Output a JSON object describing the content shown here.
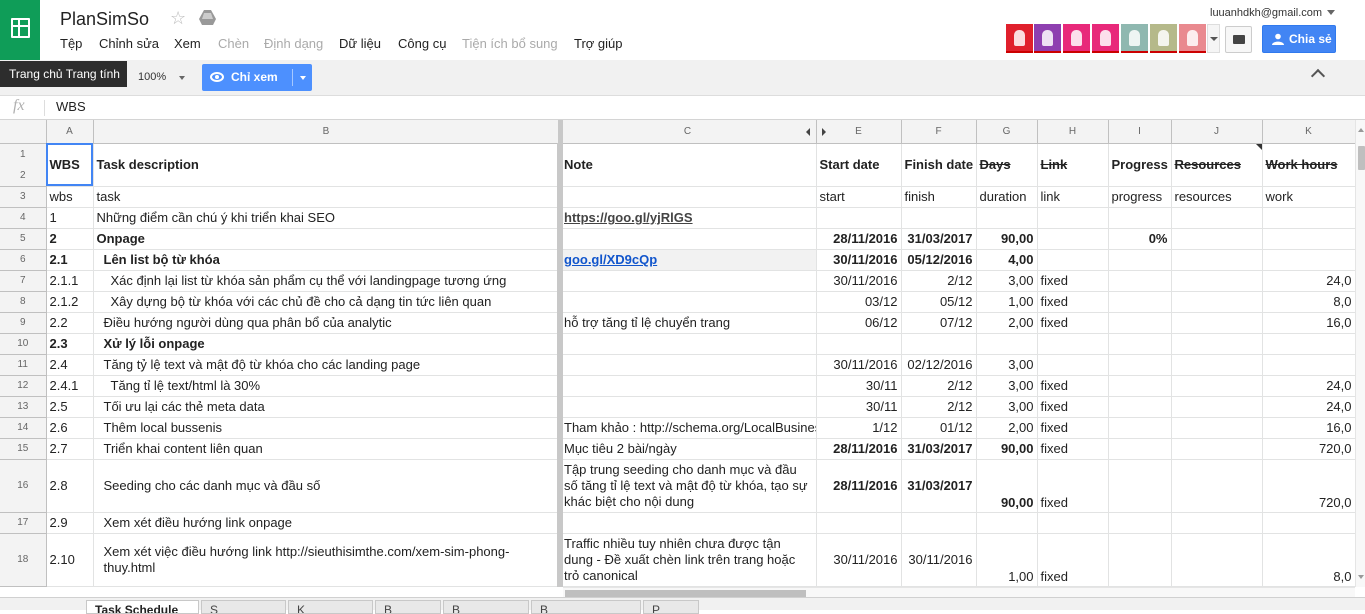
{
  "app": {
    "title": "PlanSimSo",
    "account": "luuanhdkh@gmail.com"
  },
  "menu": [
    {
      "label": "Tệp",
      "enabled": true
    },
    {
      "label": "Chỉnh sửa",
      "enabled": true
    },
    {
      "label": "Xem",
      "enabled": true
    },
    {
      "label": "Chèn",
      "enabled": false
    },
    {
      "label": "Định dạng",
      "enabled": false
    },
    {
      "label": "Dữ liệu",
      "enabled": true
    },
    {
      "label": "Công cụ",
      "enabled": true
    },
    {
      "label": "Tiện ích bổ sung",
      "enabled": false
    },
    {
      "label": "Trợ giúp",
      "enabled": true
    }
  ],
  "toolbar": {
    "home_tooltip": "Trang chủ Trang tính",
    "zoom": "100%",
    "view_only": "Chỉ xem",
    "share": "Chia sẻ"
  },
  "collaborators": [
    {
      "color": "#e0202c"
    },
    {
      "color": "#8e3fb0"
    },
    {
      "color": "#e8297a"
    },
    {
      "color": "#e8297a"
    },
    {
      "color": "#8fb8b0"
    },
    {
      "color": "#b5b98a"
    },
    {
      "color": "#e9898f"
    }
  ],
  "formula_bar": {
    "value": "WBS"
  },
  "columns": [
    "A",
    "B",
    "C",
    "E",
    "F",
    "G",
    "H",
    "I",
    "J",
    "K"
  ],
  "rows": [
    {
      "n": "1",
      "n2": "2",
      "wbs": "WBS",
      "task": "Task description",
      "note": "Note",
      "start": "Start date",
      "finish": "Finish date",
      "days": "Days",
      "link": "Link",
      "progress": "Progress",
      "resources": "Resources",
      "work": "Work hours"
    },
    {
      "n": "3",
      "wbs": "wbs",
      "task": "task",
      "note": "",
      "start": "start",
      "finish": "finish",
      "days": "duration",
      "link": "link",
      "progress": "progress",
      "resources": "resources",
      "work": "work"
    },
    {
      "n": "4",
      "wbs": "1",
      "task": "Những điểm cần chú ý khi triển khai SEO",
      "note": "https://goo.gl/yjRlGS",
      "start": "",
      "finish": "",
      "days": "",
      "link": "",
      "progress": "",
      "resources": "",
      "work": ""
    },
    {
      "n": "5",
      "wbs": "2",
      "task": "Onpage",
      "note": "",
      "start": "28/11/2016",
      "finish": "31/03/2017",
      "days": "90,00",
      "link": "",
      "progress": "0%",
      "resources": "",
      "work": ""
    },
    {
      "n": "6",
      "wbs": "2.1",
      "task": "Lên list bộ từ khóa",
      "note": "goo.gl/XD9cQp",
      "start": "30/11/2016",
      "finish": "05/12/2016",
      "days": "4,00",
      "link": "",
      "progress": "",
      "resources": "",
      "work": ""
    },
    {
      "n": "7",
      "wbs": "2.1.1",
      "task": "Xác định lại list từ khóa sản phẩm cụ thể với landingpage tương ứng",
      "note": "",
      "start": "30/11/2016",
      "finish": "2/12",
      "days": "3,00",
      "link": "fixed",
      "progress": "",
      "resources": "",
      "work": "24,0"
    },
    {
      "n": "8",
      "wbs": "2.1.2",
      "task": "Xây dựng bộ từ khóa với các chủ đề cho cả dạng tin tức liên quan",
      "note": "",
      "start": "03/12",
      "finish": "05/12",
      "days": "1,00",
      "link": "fixed",
      "progress": "",
      "resources": "",
      "work": "8,0"
    },
    {
      "n": "9",
      "wbs": "2.2",
      "task": "Điều hướng người dùng qua phân bổ của analytic",
      "note": "hỗ trợ tăng tỉ lệ chuyển trang",
      "start": "06/12",
      "finish": "07/12",
      "days": "2,00",
      "link": "fixed",
      "progress": "",
      "resources": "",
      "work": "16,0"
    },
    {
      "n": "10",
      "wbs": "2.3",
      "task": "Xử lý lỗi onpage",
      "note": "",
      "start": "",
      "finish": "",
      "days": "",
      "link": "",
      "progress": "",
      "resources": "",
      "work": ""
    },
    {
      "n": "11",
      "wbs": "2.4",
      "task": "Tăng tỷ lệ text và mật độ từ khóa cho các landing page",
      "note": "",
      "start": "30/11/2016",
      "finish": "02/12/2016",
      "days": "3,00",
      "link": "",
      "progress": "",
      "resources": "",
      "work": ""
    },
    {
      "n": "12",
      "wbs": "2.4.1",
      "task": "Tăng tỉ lệ text/html là 30%",
      "note": "",
      "start": "30/11",
      "finish": "2/12",
      "days": "3,00",
      "link": "fixed",
      "progress": "",
      "resources": "",
      "work": "24,0"
    },
    {
      "n": "13",
      "wbs": "2.5",
      "task": "Tối ưu lại các thẻ meta data",
      "note": "",
      "start": "30/11",
      "finish": "2/12",
      "days": "3,00",
      "link": "fixed",
      "progress": "",
      "resources": "",
      "work": "24,0"
    },
    {
      "n": "14",
      "wbs": "2.6",
      "task": "Thêm local bussenis",
      "note": "Tham khảo : http://schema.org/LocalBusiness",
      "start": "1/12",
      "finish": "01/12",
      "days": "2,00",
      "link": "fixed",
      "progress": "",
      "resources": "",
      "work": "16,0"
    },
    {
      "n": "15",
      "wbs": "2.7",
      "task": "Triển khai content liên quan",
      "note": "Mục tiêu 2 bài/ngày",
      "start": "28/11/2016",
      "finish": "31/03/2017",
      "days": "90,00",
      "link": "fixed",
      "progress": "",
      "resources": "",
      "work": "720,0"
    },
    {
      "n": "16",
      "wbs": "2.8",
      "task": "Seeding cho các danh mục và đầu số",
      "note": "Tập trung seeding cho danh mục và đầu số tăng tỉ lệ text và mật độ từ khóa, tạo sự khác biệt cho nội dung",
      "start": "28/11/2016",
      "finish": "31/03/2017",
      "days": "90,00",
      "link": "fixed",
      "progress": "",
      "resources": "",
      "work": "720,0"
    },
    {
      "n": "17",
      "wbs": "2.9",
      "task": "Xem xét điều hướng link onpage",
      "note": "",
      "start": "",
      "finish": "",
      "days": "",
      "link": "",
      "progress": "",
      "resources": "",
      "work": ""
    },
    {
      "n": "18",
      "wbs": "2.10",
      "task": "Xem xét việc điều hướng link http://sieuthisimthe.com/xem-sim-phong-thuy.html",
      "note": "Traffic nhiều tuy nhiên chưa được tận dung - Đề xuất chèn link trên trang hoặc trỏ canonical",
      "start": "30/11/2016",
      "finish": "30/11/2016",
      "days": "1,00",
      "link": "fixed",
      "progress": "",
      "resources": "",
      "work": "8,0"
    }
  ],
  "sheet_tabs": [
    "Task Schedule",
    "S",
    "K",
    "B",
    "B",
    "B",
    "P"
  ]
}
